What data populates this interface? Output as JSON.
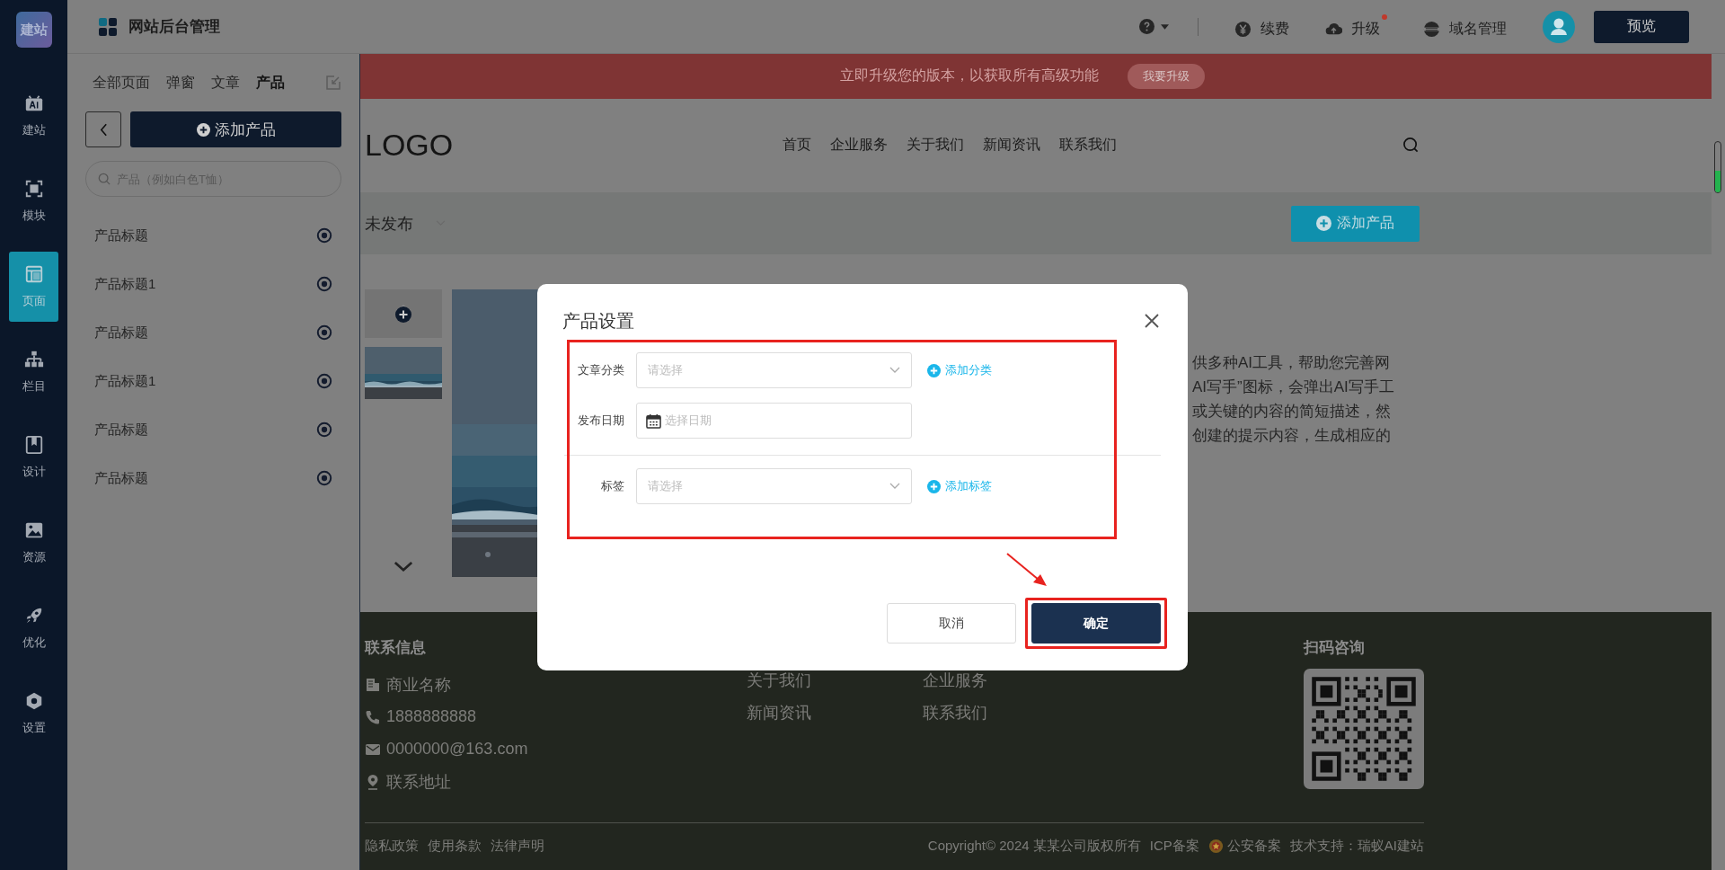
{
  "sidebar": {
    "logo": "建站",
    "items": [
      {
        "label": "建站",
        "selected": false
      },
      {
        "label": "模块",
        "selected": false
      },
      {
        "label": "页面",
        "selected": true
      },
      {
        "label": "栏目",
        "selected": false
      },
      {
        "label": "设计",
        "selected": false
      },
      {
        "label": "资源",
        "selected": false
      },
      {
        "label": "优化",
        "selected": false
      },
      {
        "label": "设置",
        "selected": false
      }
    ]
  },
  "top_bar": {
    "title": "网站后台管理",
    "actions": [
      {
        "label": "续费",
        "notify": false
      },
      {
        "label": "升级",
        "notify": true
      },
      {
        "label": "域名管理",
        "notify": false
      }
    ],
    "preview_button": "预览"
  },
  "panel": {
    "tabs": [
      {
        "label": "全部页面",
        "selected": false
      },
      {
        "label": "弹窗",
        "selected": false
      },
      {
        "label": "文章",
        "selected": false
      },
      {
        "label": "产品",
        "selected": true
      }
    ],
    "add_button": "添加产品",
    "search": {
      "placeholder": "产品（例如白色T恤）"
    },
    "items": [
      "产品标题",
      "产品标题1",
      "产品标题",
      "产品标题1",
      "产品标题",
      "产品标题"
    ]
  },
  "banner": {
    "text": "立即升级您的版本，以获取所有高级功能",
    "button": "我要升级"
  },
  "site_header": {
    "logo": "LOGO",
    "nav": [
      "首页",
      "企业服务",
      "关于我们",
      "新闻资讯",
      "联系我们"
    ]
  },
  "filter_bar": {
    "status": "未发布",
    "add_button": "添加产品"
  },
  "product": {
    "description_lines": [
      "供多种AI工具，帮助您完善网",
      "AI写手”图标，会弹出AI写手工",
      "或关键的内容的简短描述，然",
      "创建的提示内容，生成相应的"
    ]
  },
  "footer": {
    "contact_title": "联系信息",
    "contacts": [
      {
        "kind": "company",
        "text": "商业名称"
      },
      {
        "kind": "phone",
        "text": "1888888888"
      },
      {
        "kind": "email",
        "text": "0000000@163.com"
      },
      {
        "kind": "address",
        "text": "联系地址"
      }
    ],
    "link_columns": [
      [
        "关于我们",
        "新闻资讯"
      ],
      [
        "企业服务",
        "联系我们"
      ]
    ],
    "qr_title": "扫码咨询",
    "legal_links": [
      "隐私政策",
      "使用条款",
      "法律声明"
    ],
    "copyright": "Copyright© 2024 某某公司版权所有",
    "icp": "ICP备案",
    "police": "公安备案",
    "support": "技术支持：瑞蚁AI建站"
  },
  "modal": {
    "title": "产品设置",
    "form_highlighted": true,
    "field_groups": [
      [
        {
          "label": "文章分类",
          "kind": "select",
          "placeholder": "请选择",
          "action": "添加分类"
        },
        {
          "label": "发布日期",
          "kind": "date",
          "placeholder": "选择日期"
        }
      ],
      [
        {
          "label": "标签",
          "kind": "select",
          "placeholder": "请选择",
          "action": "添加标签"
        }
      ]
    ],
    "buttons": [
      {
        "label": "取消",
        "kind": "secondary",
        "highlighted": false
      },
      {
        "label": "确定",
        "kind": "primary",
        "highlighted": true
      }
    ]
  }
}
